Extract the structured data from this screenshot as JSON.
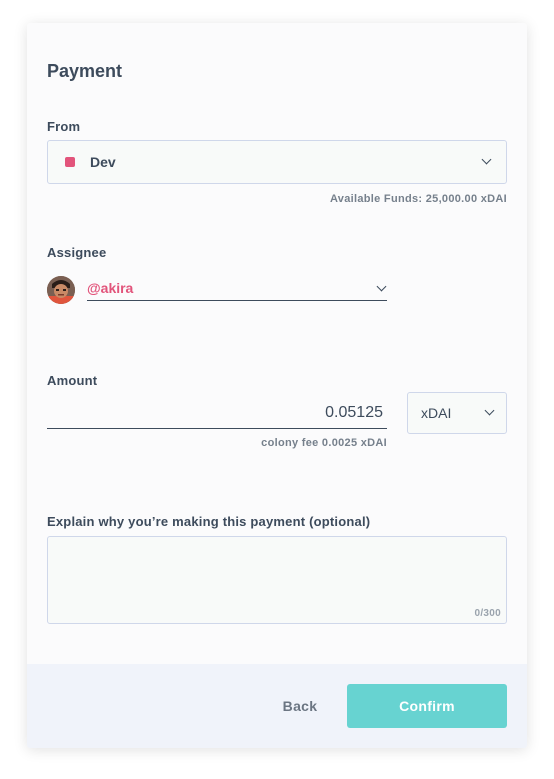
{
  "dialog": {
    "title": "Payment"
  },
  "from": {
    "label": "From",
    "selected_team": "Dev",
    "team_color": "#e2547b",
    "available_funds": "Available Funds: 25,000.00 xDAI"
  },
  "assignee": {
    "label": "Assignee",
    "selected_user": "@akira",
    "avatar_icon": "user-avatar"
  },
  "amount": {
    "label": "Amount",
    "value": "0.05125",
    "fee": "colony fee 0.0025 xDAI",
    "token": "xDAI"
  },
  "annotation": {
    "label": "Explain why you’re making this payment (optional)",
    "value": "",
    "counter": "0/300"
  },
  "actions": {
    "back_label": "Back",
    "confirm_label": "Confirm",
    "confirm_color": "#67d3d1"
  }
}
